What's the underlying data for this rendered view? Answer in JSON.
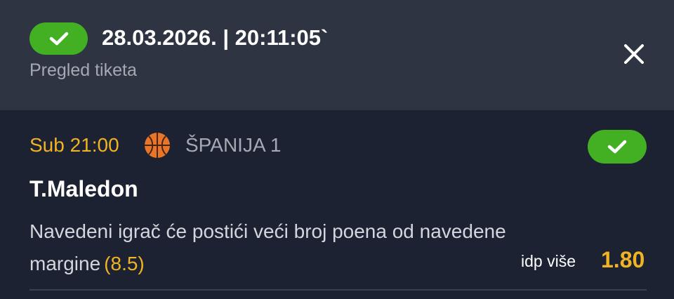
{
  "header": {
    "datetime": "28.03.2026. | 20:11:05`",
    "subtitle": "Pregled tiketa",
    "status_icon": "check-icon",
    "close_icon": "close-icon"
  },
  "bet": {
    "match_time": "Sub 21:00",
    "sport_icon": "basketball-icon",
    "league": "ŠPANIJA 1",
    "player": "T.Maledon",
    "description": "Navedeni igrač će postići veći broj poena od navedene margine",
    "line": "(8.5)",
    "outcome": "idp više",
    "odds": "1.80",
    "result_icon": "check-icon"
  },
  "colors": {
    "header_bg": "#2e3442",
    "card_bg": "#1c2232",
    "win_green": "#43b023",
    "accent_yellow": "#f0b323",
    "muted_text": "#a4a9b3"
  }
}
